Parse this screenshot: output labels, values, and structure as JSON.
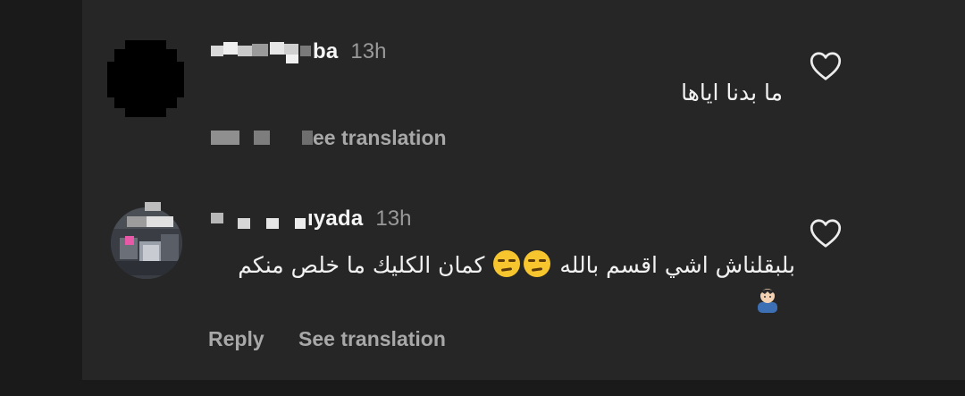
{
  "comments": [
    {
      "username_visible": "ba",
      "time": "13h",
      "text": "ما بدنا اياها",
      "action_see_translation": "ee translation",
      "like_icon": "heart-outline-icon"
    },
    {
      "username_visible": "ıyada",
      "time": "13h",
      "text_before_emoji": "بلبقلناش اشي اقسم بالله",
      "text_after_emoji": "كمان الكليك ما خلص منكم",
      "emojis": [
        "unamused-face-emoji",
        "unamused-face-emoji",
        "person-emoji"
      ],
      "action_reply": "Reply",
      "action_see_translation": "See translation",
      "like_icon": "heart-outline-icon"
    }
  ],
  "colors": {
    "background": "#1a1a1a",
    "panel": "#262626",
    "text": "#f2f2f2",
    "muted": "#a8a8a8",
    "timestamp": "#9a9a9a"
  }
}
